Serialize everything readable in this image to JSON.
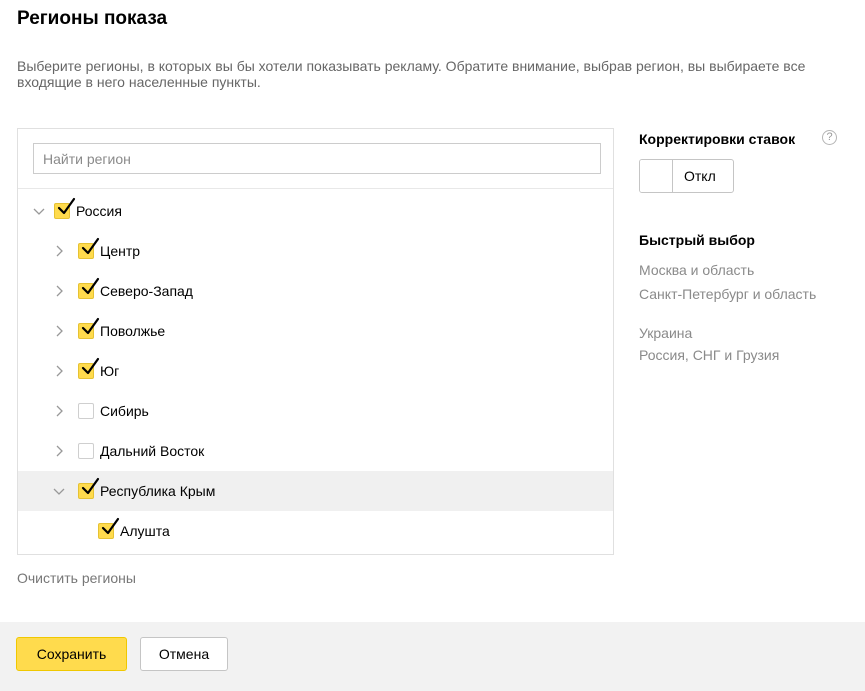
{
  "header": {
    "title": "Регионы показа",
    "description": "Выберите регионы, в которых вы бы хотели показывать рекламу. Обратите внимание, выбрав регион, вы выбираете все входящие в него населенные пункты."
  },
  "tree": {
    "search_placeholder": "Найти регион",
    "items": [
      {
        "label": "Россия",
        "checked": true,
        "expanded": true,
        "level": 0
      },
      {
        "label": "Центр",
        "checked": true,
        "expanded": false,
        "level": 1
      },
      {
        "label": "Северо-Запад",
        "checked": true,
        "expanded": false,
        "level": 1
      },
      {
        "label": "Поволжье",
        "checked": true,
        "expanded": false,
        "level": 1
      },
      {
        "label": "Юг",
        "checked": true,
        "expanded": false,
        "level": 1
      },
      {
        "label": "Сибирь",
        "checked": false,
        "expanded": false,
        "level": 1
      },
      {
        "label": "Дальний Восток",
        "checked": false,
        "expanded": false,
        "level": 1
      },
      {
        "label": "Республика Крым",
        "checked": true,
        "expanded": true,
        "level": 1,
        "highlighted": true
      },
      {
        "label": "Алушта",
        "checked": true,
        "expanded": null,
        "level": 2
      }
    ],
    "clear_label": "Очистить регионы"
  },
  "sidebar": {
    "bid_adjustments_title": "Корректировки ставок",
    "help_symbol": "?",
    "toggle_label": "Откл",
    "quick_select_title": "Быстрый выбор",
    "quick_items": [
      "Москва и область",
      "Санкт-Петербург и область",
      "Украина",
      "Россия, СНГ и Грузия"
    ]
  },
  "footer": {
    "save_label": "Сохранить",
    "cancel_label": "Отмена"
  },
  "colors": {
    "accent_yellow": "#ffdb4d",
    "muted_text": "#8a8a8a",
    "footer_bg": "#f2f2f2"
  }
}
